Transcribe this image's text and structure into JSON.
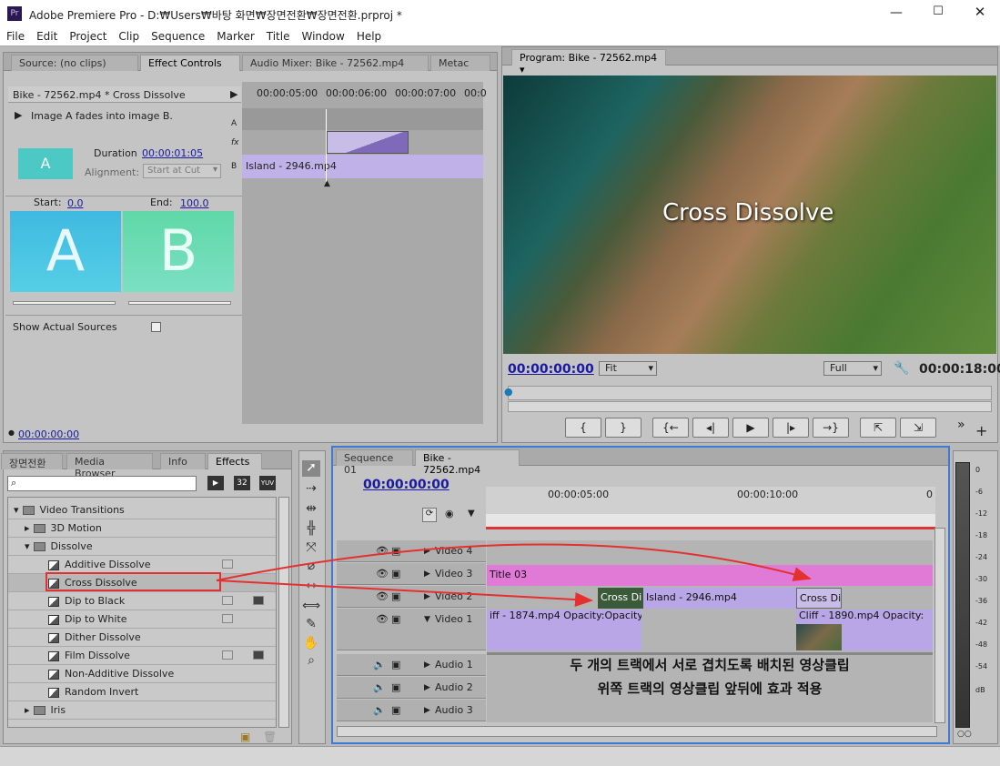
{
  "app": {
    "title": "Adobe Premiere Pro - D:₩Users₩바탕 화면₩장면전환₩장면전환.prproj *",
    "icon_text": "Pr"
  },
  "menu": [
    "File",
    "Edit",
    "Project",
    "Clip",
    "Sequence",
    "Marker",
    "Title",
    "Window",
    "Help"
  ],
  "source_tabs": {
    "source": "Source: (no clips)",
    "effect_controls": "Effect Controls",
    "audio_mixer": "Audio Mixer: Bike - 72562.mp4",
    "meta": "Metac"
  },
  "effect_controls": {
    "header": "Bike - 72562.mp4 * Cross Dissolve",
    "desc": "Image A fades into image B.",
    "duration_label": "Duration",
    "duration": "00:00:01:05",
    "alignment_label": "Alignment:",
    "alignment": "Start at Cut",
    "start_label": "Start:",
    "start": "0.0",
    "end_label": "End:",
    "end": "100.0",
    "a": "A",
    "b": "B",
    "show_actual": "Show Actual Sources",
    "timecode": "00:00:00:00",
    "ruler": [
      "00:00:05:00",
      "00:00:06:00",
      "00:00:07:00",
      "00:0"
    ],
    "track_a": "A",
    "track_fx": "fx",
    "track_b": "B",
    "clip": "Island - 2946.mp4"
  },
  "program": {
    "tab": "Program: Bike - 72562.mp4",
    "overlay": "Cross Dissolve",
    "timecode": "00:00:00:00",
    "fit": "Fit",
    "full": "Full",
    "duration": "00:00:18:00",
    "buttons": [
      "{",
      "}",
      "{←",
      "◂|",
      "▶",
      "|▸",
      "→}",
      "⇱",
      "⇲"
    ]
  },
  "project_tabs": {
    "t1": "장면전환",
    "t2": "Media Browser",
    "t3": "Info",
    "t4": "Effects"
  },
  "effects": {
    "badges": [
      "32",
      "YUV"
    ],
    "tree": [
      {
        "label": "Video Transitions",
        "level": 0,
        "type": "folder"
      },
      {
        "label": "3D Motion",
        "level": 1,
        "type": "folder"
      },
      {
        "label": "Dissolve",
        "level": 1,
        "type": "folder"
      },
      {
        "label": "Additive Dissolve",
        "level": 2,
        "type": "fx"
      },
      {
        "label": "Cross Dissolve",
        "level": 2,
        "type": "fx"
      },
      {
        "label": "Dip to Black",
        "level": 2,
        "type": "fx"
      },
      {
        "label": "Dip to White",
        "level": 2,
        "type": "fx"
      },
      {
        "label": "Dither Dissolve",
        "level": 2,
        "type": "fx"
      },
      {
        "label": "Film Dissolve",
        "level": 2,
        "type": "fx"
      },
      {
        "label": "Non-Additive Dissolve",
        "level": 2,
        "type": "fx"
      },
      {
        "label": "Random Invert",
        "level": 2,
        "type": "fx"
      },
      {
        "label": "Iris",
        "level": 1,
        "type": "folder"
      }
    ]
  },
  "timeline": {
    "tab1": "Sequence 01",
    "tab2": "Bike - 72562.mp4",
    "timecode": "00:00:00:00",
    "ruler": [
      "00:00:05:00",
      "00:00:10:00",
      "0"
    ],
    "tracks": [
      "Video 4",
      "Video 3",
      "Video 2",
      "Video 1",
      "Audio 1",
      "Audio 2",
      "Audio 3"
    ],
    "clips": {
      "title": "Title 03",
      "cross1": "Cross Di",
      "island": "Island - 2946.mp4",
      "cross2": "Cross Di",
      "cliff1": "iff - 1874.mp4",
      "opacity1": "Opacity:Opacity",
      "cliff2": "Cliff - 1890.mp4",
      "opacity2": "Opacity:"
    },
    "annotation1": "두 개의 트랙에서 서로 겹치도록 배치된 영상클립",
    "annotation2": "위쪽 트랙의 영상클립 앞뒤에 효과 적용"
  },
  "meter": [
    "0",
    "-6",
    "-12",
    "-18",
    "-24",
    "-30",
    "-36",
    "-42",
    "-48",
    "-54",
    "dB"
  ],
  "colors": {
    "title_clip": "#e07ad6",
    "video_clip": "#b8a6e6",
    "highlight": "#e53030",
    "timecode": "#1a1aa0"
  }
}
